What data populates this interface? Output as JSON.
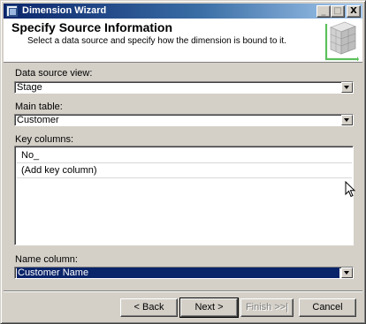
{
  "window": {
    "title": "Dimension Wizard",
    "controls": {
      "minimize": "_",
      "maximize": "□",
      "close": "X"
    }
  },
  "header": {
    "title": "Specify Source Information",
    "subtitle": "Select a data source and specify how the dimension is bound to it."
  },
  "form": {
    "data_source_view": {
      "label": "Data source view:",
      "value": "Stage"
    },
    "main_table": {
      "label": "Main table:",
      "value": "Customer"
    },
    "key_columns": {
      "label": "Key columns:",
      "rows": [
        "No_",
        "(Add key column)"
      ]
    },
    "name_column": {
      "label": "Name column:",
      "value": "Customer Name"
    }
  },
  "buttons": {
    "back": "< Back",
    "next": "Next >",
    "finish": "Finish >>|",
    "cancel": "Cancel"
  },
  "colors": {
    "titlebar_start": "#0a246a",
    "titlebar_end": "#a6caf0",
    "selection": "#0a246a",
    "face": "#d4d0c8"
  }
}
